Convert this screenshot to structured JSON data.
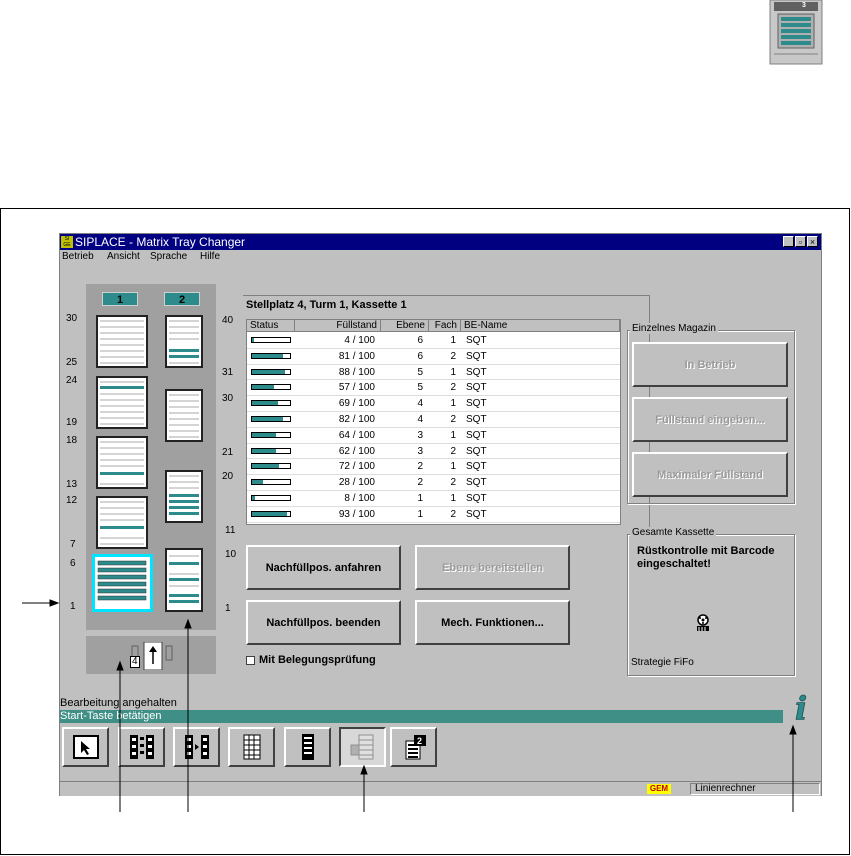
{
  "top_icon": {
    "number": "3"
  },
  "window": {
    "title": "SIPLACE - Matrix Tray Changer",
    "logo_text": "SI\nGE",
    "controls": [
      "_",
      "▫",
      "×"
    ],
    "menu": [
      "Betrieb",
      "Ansicht",
      "Sprache",
      "Hilfe"
    ]
  },
  "towers": {
    "headers": [
      "1",
      "2"
    ],
    "left_scale": [
      "30",
      "25",
      "24",
      "19",
      "18",
      "13",
      "12",
      "7",
      "6",
      "1"
    ],
    "right_scale": [
      "40",
      "31",
      "30",
      "21",
      "20",
      "11",
      "10",
      "1"
    ],
    "position_indicator": "4"
  },
  "table": {
    "title": "Stellplatz 4, Turm 1, Kassette 1",
    "columns": [
      "Status",
      "Füllstand",
      "Ebene",
      "Fach",
      "BE-Name"
    ],
    "rows": [
      {
        "level": 0.04,
        "fill": "4 / 100",
        "ebene": "6",
        "fach": "1",
        "name": "SQT"
      },
      {
        "level": 0.81,
        "fill": "81 / 100",
        "ebene": "6",
        "fach": "2",
        "name": "SQT"
      },
      {
        "level": 0.88,
        "fill": "88 / 100",
        "ebene": "5",
        "fach": "1",
        "name": "SQT"
      },
      {
        "level": 0.57,
        "fill": "57 / 100",
        "ebene": "5",
        "fach": "2",
        "name": "SQT"
      },
      {
        "level": 0.69,
        "fill": "69 / 100",
        "ebene": "4",
        "fach": "1",
        "name": "SQT"
      },
      {
        "level": 0.82,
        "fill": "82 / 100",
        "ebene": "4",
        "fach": "2",
        "name": "SQT"
      },
      {
        "level": 0.64,
        "fill": "64 / 100",
        "ebene": "3",
        "fach": "1",
        "name": "SQT"
      },
      {
        "level": 0.62,
        "fill": "62 / 100",
        "ebene": "3",
        "fach": "2",
        "name": "SQT"
      },
      {
        "level": 0.72,
        "fill": "72 / 100",
        "ebene": "2",
        "fach": "1",
        "name": "SQT"
      },
      {
        "level": 0.28,
        "fill": "28 / 100",
        "ebene": "2",
        "fach": "2",
        "name": "SQT"
      },
      {
        "level": 0.08,
        "fill": "8 / 100",
        "ebene": "1",
        "fach": "1",
        "name": "SQT"
      },
      {
        "level": 0.93,
        "fill": "93 / 100",
        "ebene": "1",
        "fach": "2",
        "name": "SQT"
      }
    ]
  },
  "buttons": {
    "refill_approach": "Nachfüllpos. anfahren",
    "level_provide": "Ebene bereitstellen",
    "refill_end": "Nachfüllpos. beenden",
    "mech_functions": "Mech. Funktionen...",
    "occupancy_check": "Mit Belegungsprüfung"
  },
  "single_magazine": {
    "title": "Einzelnes Magazin",
    "in_operation": "In Betrieb",
    "enter_fill": "Füllstand eingeben...",
    "max_fill": "Maximaler Füllstand"
  },
  "whole_cassette": {
    "title": "Gesamte Kassette",
    "message": "Rüstkontrolle mit Barcode eingeschaltet!",
    "strategy": "Strategie FiFo"
  },
  "status": {
    "line1": "Bearbeitung angehalten",
    "line2": "Start-Taste betätigen"
  },
  "statusbar": {
    "gem": "GEM",
    "computer": "Linienrechner"
  },
  "colors": {
    "teal": "#2e8b8b",
    "selection": "#00e5ff",
    "title_blue": "#000080"
  }
}
